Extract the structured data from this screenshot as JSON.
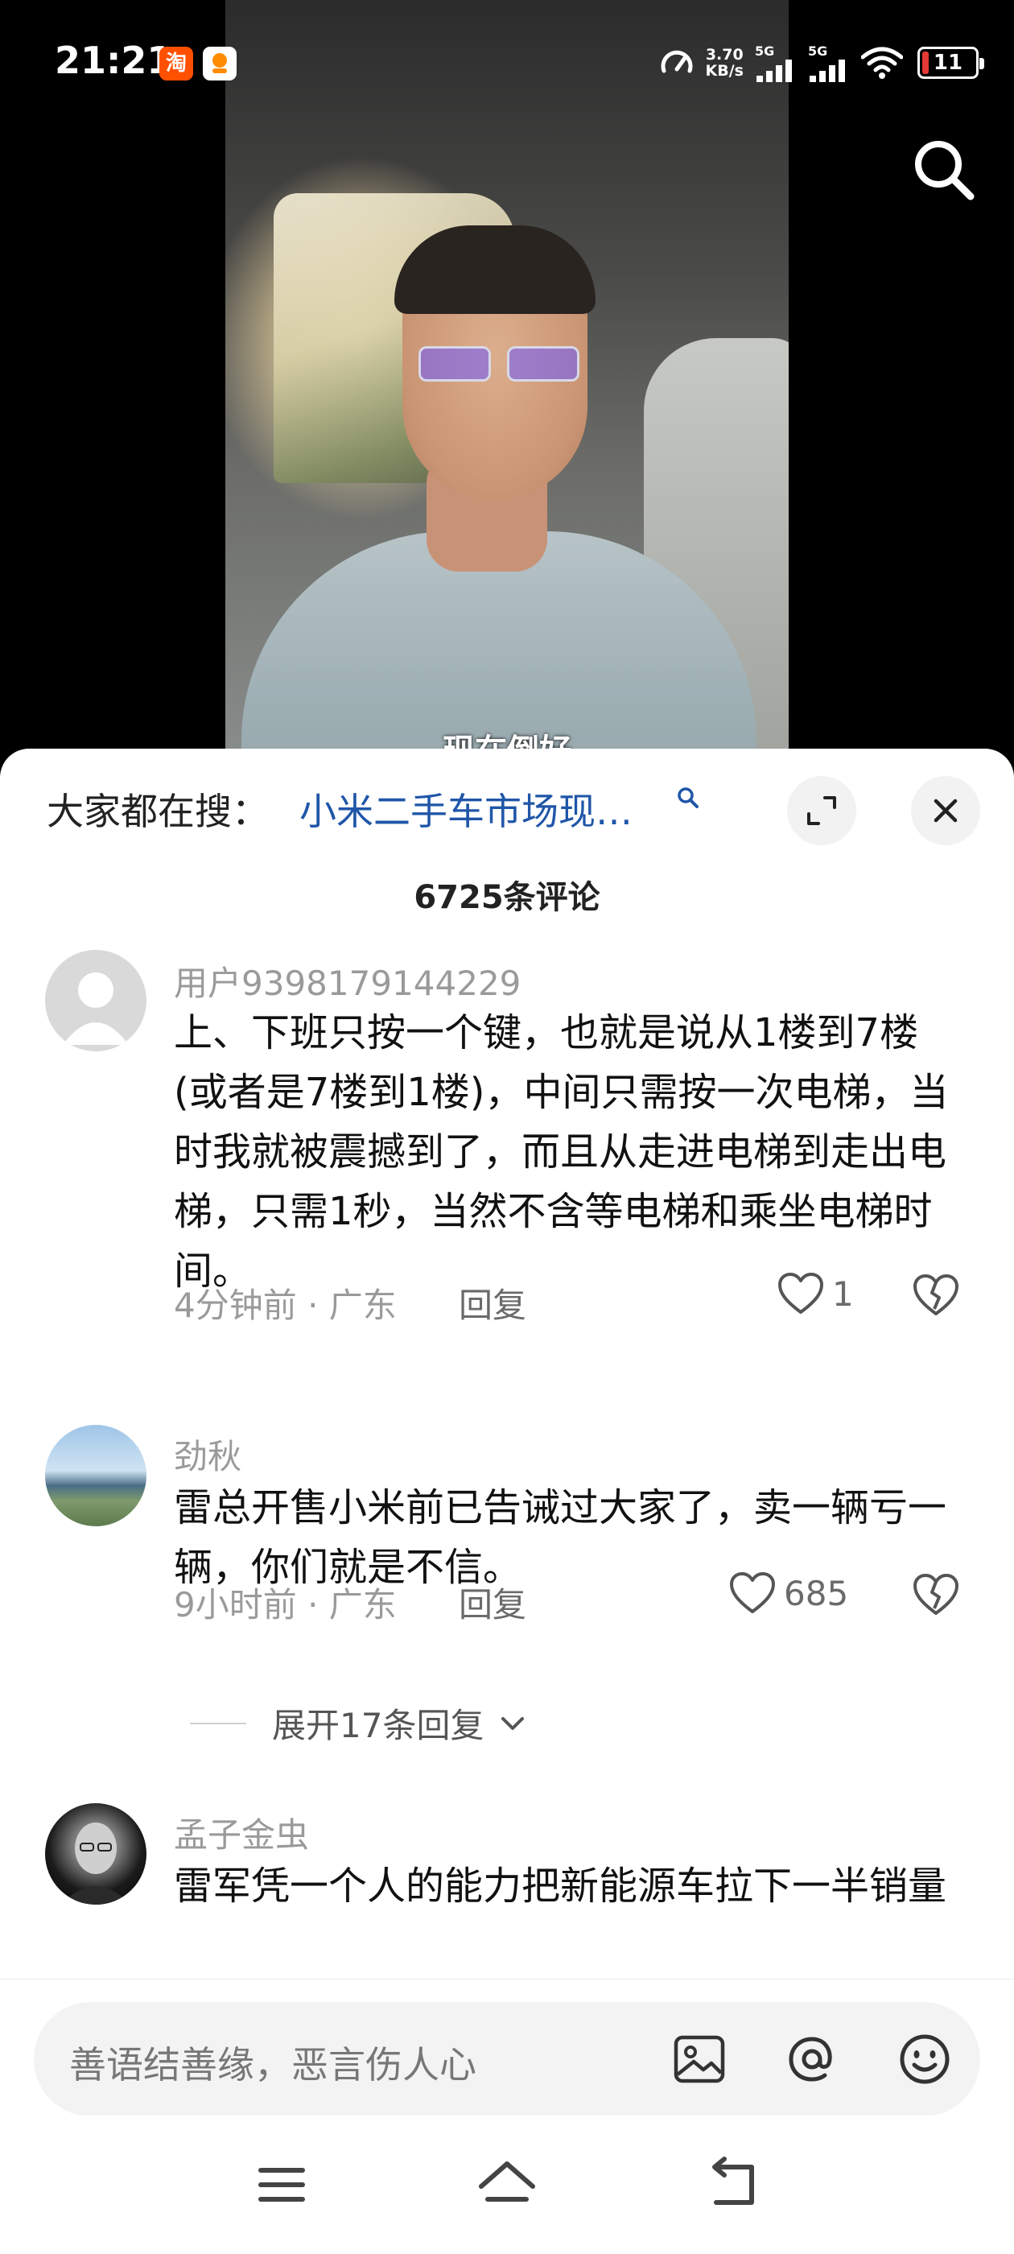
{
  "status_bar": {
    "time": "21:21",
    "net_speed_value": "3.70",
    "net_speed_unit": "KB/s",
    "sim1_label": "5G",
    "sim2_label": "5G",
    "battery_level": "11",
    "battery_percent": 11,
    "app_badges": [
      "taobao-app-icon",
      "orange-app-icon"
    ],
    "taobao_glyph": "淘"
  },
  "video": {
    "caption_peek": "现在倒好"
  },
  "sheet": {
    "search_prefix": "大家都在搜：",
    "search_term": "小米二手车市场现…",
    "comment_count": "6725条评论"
  },
  "comments": [
    {
      "username": "用户9398179144229",
      "text": "上、下班只按一个键，也就是说从1楼到7楼(或者是7楼到1楼)，中间只需按一次电梯，当时我就被震撼到了，而且从走进电梯到走出电梯，只需1秒，当然不含等电梯和乘坐电梯时间。",
      "meta": "4分钟前 · 广东",
      "reply": "回复",
      "likes": "1"
    },
    {
      "username": "劲秋",
      "text": "雷总开售小米前已告诫过大家了，卖一辆亏一辆，你们就是不信。",
      "meta": "9小时前 · 广东",
      "reply": "回复",
      "likes": "685",
      "expand_replies": "展开17条回复"
    },
    {
      "username": "孟子金虫",
      "text": "雷军凭一个人的能力把新能源车拉下一半销量"
    }
  ],
  "input": {
    "placeholder": "善语结善缘，恶言伤人心"
  },
  "colors": {
    "search_term": "#1f56a8",
    "battery_low": "#e53935",
    "muted_text": "#9a9a9a"
  }
}
